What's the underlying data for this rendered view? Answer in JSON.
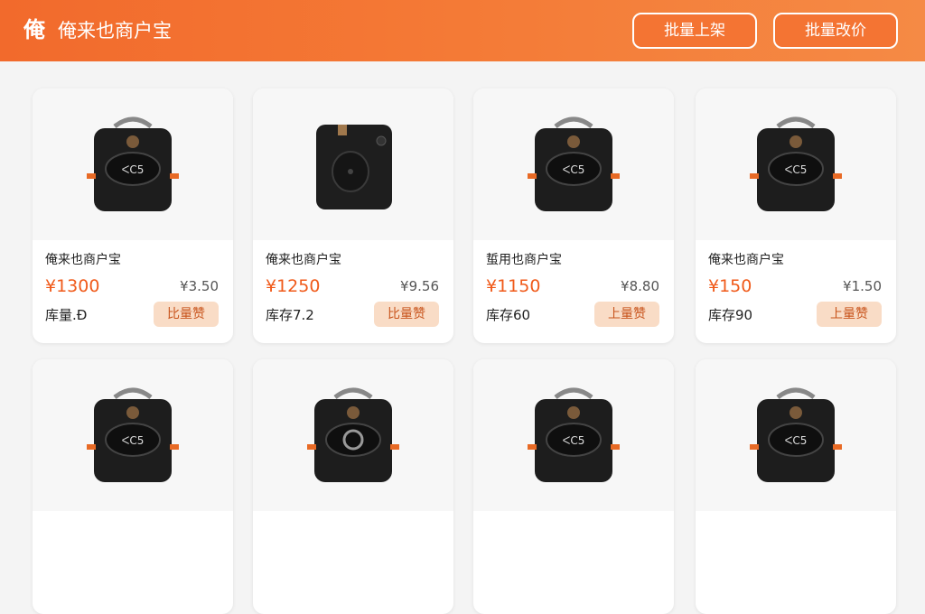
{
  "header": {
    "logo": "俺",
    "title": "俺来也商户宝",
    "batch_list_label": "批量上架",
    "batch_price_label": "批量改价",
    "color": "#f26a2c"
  },
  "products": [
    {
      "name": "俺来也商户宝",
      "price": "¥1300",
      "old_price": "¥3.50",
      "stock": "库量.Ð",
      "action": "比量赞",
      "icon": "bag-icon"
    },
    {
      "name": "俺来也商户宝",
      "price": "¥1250",
      "old_price": "¥9.56",
      "stock": "库存7.2",
      "action": "比量赞",
      "icon": "camera-bag-icon"
    },
    {
      "name": "蜇用也商户宝",
      "price": "¥1150",
      "old_price": "¥8.80",
      "stock": "库存60",
      "action": "上量赞",
      "icon": "bag-icon"
    },
    {
      "name": "俺来也商户宝",
      "price": "¥150",
      "old_price": "¥1.50",
      "stock": "库存90",
      "action": "上量赞",
      "icon": "bag-icon"
    },
    {
      "name": "",
      "price": "",
      "old_price": "",
      "stock": "",
      "action": "",
      "icon": "bag-icon"
    },
    {
      "name": "",
      "price": "",
      "old_price": "",
      "stock": "",
      "action": "",
      "icon": "bag-icon"
    },
    {
      "name": "",
      "price": "",
      "old_price": "",
      "stock": "",
      "action": "",
      "icon": "bag-icon"
    },
    {
      "name": "",
      "price": "",
      "old_price": "",
      "stock": "",
      "action": "",
      "icon": "bag-icon"
    }
  ]
}
